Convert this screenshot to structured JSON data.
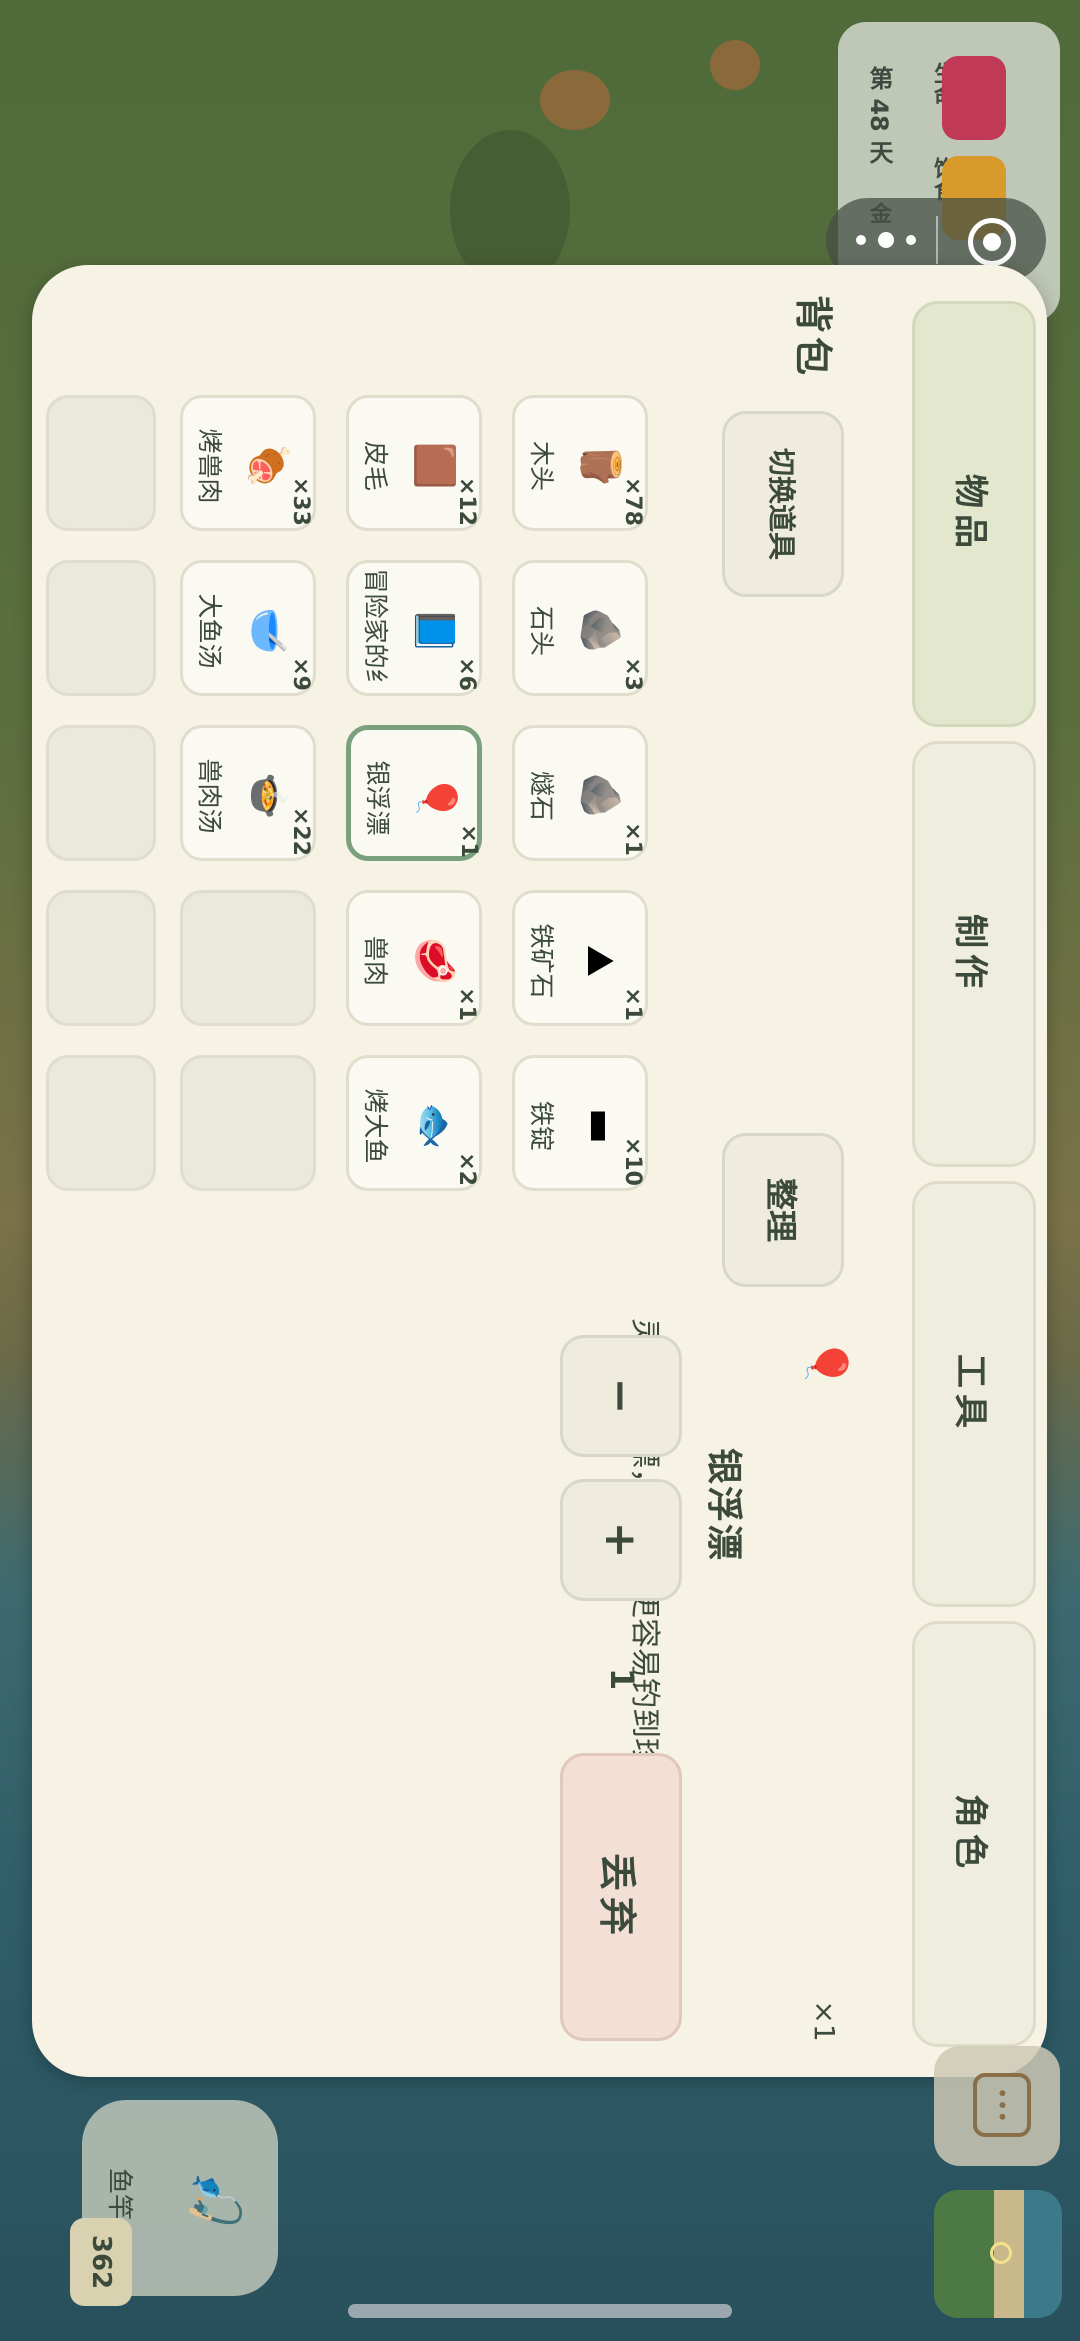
{
  "status": {
    "life_label": "生命",
    "food_label": "饱食",
    "day_label": "第 48 天",
    "gold_label": "金"
  },
  "panel": {
    "title": "背包",
    "tabs": [
      {
        "label": "物品"
      },
      {
        "label": "制作"
      },
      {
        "label": "工具"
      },
      {
        "label": "角色"
      }
    ],
    "switch_button": "切换道具",
    "sort_button": "整理",
    "items": [
      {
        "name": "木头",
        "count": "×78",
        "icon": "wood-icon",
        "glyph": "🪵"
      },
      {
        "name": "石头",
        "count": "×3",
        "icon": "stone-icon",
        "glyph": "🪨"
      },
      {
        "name": "燧石",
        "count": "×1",
        "icon": "flint-icon",
        "glyph": "🪨"
      },
      {
        "name": "铁矿石",
        "count": "×1",
        "icon": "iron-ore-icon",
        "glyph": "⛰"
      },
      {
        "name": "铁锭",
        "count": "×10",
        "icon": "iron-ingot-icon",
        "glyph": "▬"
      },
      {
        "name": "皮毛",
        "count": "×12",
        "icon": "fur-icon",
        "glyph": "🟫"
      },
      {
        "name": "冒险家的纟",
        "count": "×6",
        "icon": "book-icon",
        "glyph": "📘"
      },
      {
        "name": "银浮漂",
        "count": "×1",
        "icon": "float-icon",
        "glyph": "🎈"
      },
      {
        "name": "兽肉",
        "count": "×1",
        "icon": "meat-icon",
        "glyph": "🥩"
      },
      {
        "name": "烤大鱼",
        "count": "×2",
        "icon": "grilled-fish-icon",
        "glyph": "🐟"
      },
      {
        "name": "烤兽肉",
        "count": "×33",
        "icon": "grilled-meat-icon",
        "glyph": "🍖"
      },
      {
        "name": "大鱼汤",
        "count": "×9",
        "icon": "fish-soup-icon",
        "glyph": "🥣"
      },
      {
        "name": "兽肉汤",
        "count": "×22",
        "icon": "meat-soup-icon",
        "glyph": "🍲"
      }
    ]
  },
  "detail": {
    "name": "银浮漂",
    "description": "灵巧的浮漂，有饵时更容易钓到珍宝。",
    "owned": "×1",
    "minus": "−",
    "plus": "+",
    "quantity": "1",
    "discard": "丢弃"
  },
  "hud": {
    "rod_label": "鱼竿",
    "rod_count": "362"
  }
}
